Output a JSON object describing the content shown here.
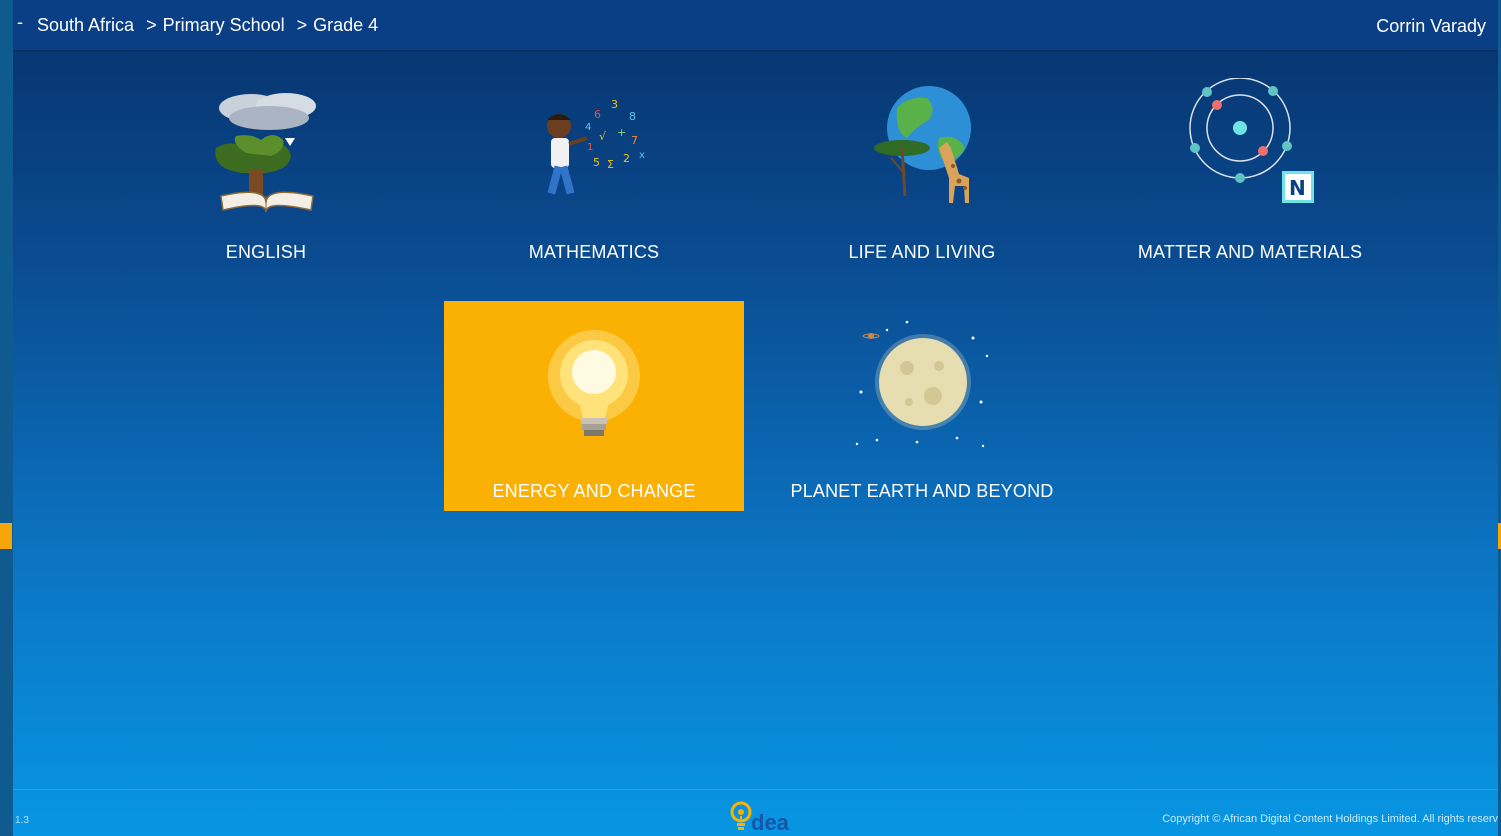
{
  "header": {
    "menu_symbol": "-",
    "breadcrumb": [
      {
        "label": "South Africa"
      },
      {
        "label": "Primary School"
      },
      {
        "label": "Grade 4"
      }
    ],
    "separator": ">",
    "user": "Corrin Varady"
  },
  "subjects": [
    {
      "label": "ENGLISH",
      "icon": "book-tree-icon"
    },
    {
      "label": "MATHEMATICS",
      "icon": "math-boy-icon"
    },
    {
      "label": "LIFE AND LIVING",
      "icon": "globe-giraffe-icon"
    },
    {
      "label": "MATTER AND MATERIALS",
      "icon": "atom-icon",
      "badge": "N"
    },
    {
      "label": "ENERGY AND CHANGE",
      "icon": "lightbulb-icon",
      "selected": true
    },
    {
      "label": "PLANET EARTH AND BEYOND",
      "icon": "moon-icon"
    }
  ],
  "footer": {
    "version": "1.3",
    "logo_text": "dea",
    "copyright": "Copyright © African Digital Content Holdings Limited. All rights reserv"
  },
  "colors": {
    "accent": "#fab104",
    "header_bg": "#0a3f86",
    "gradient_top": "#07326b",
    "gradient_bottom": "#0796e3"
  }
}
